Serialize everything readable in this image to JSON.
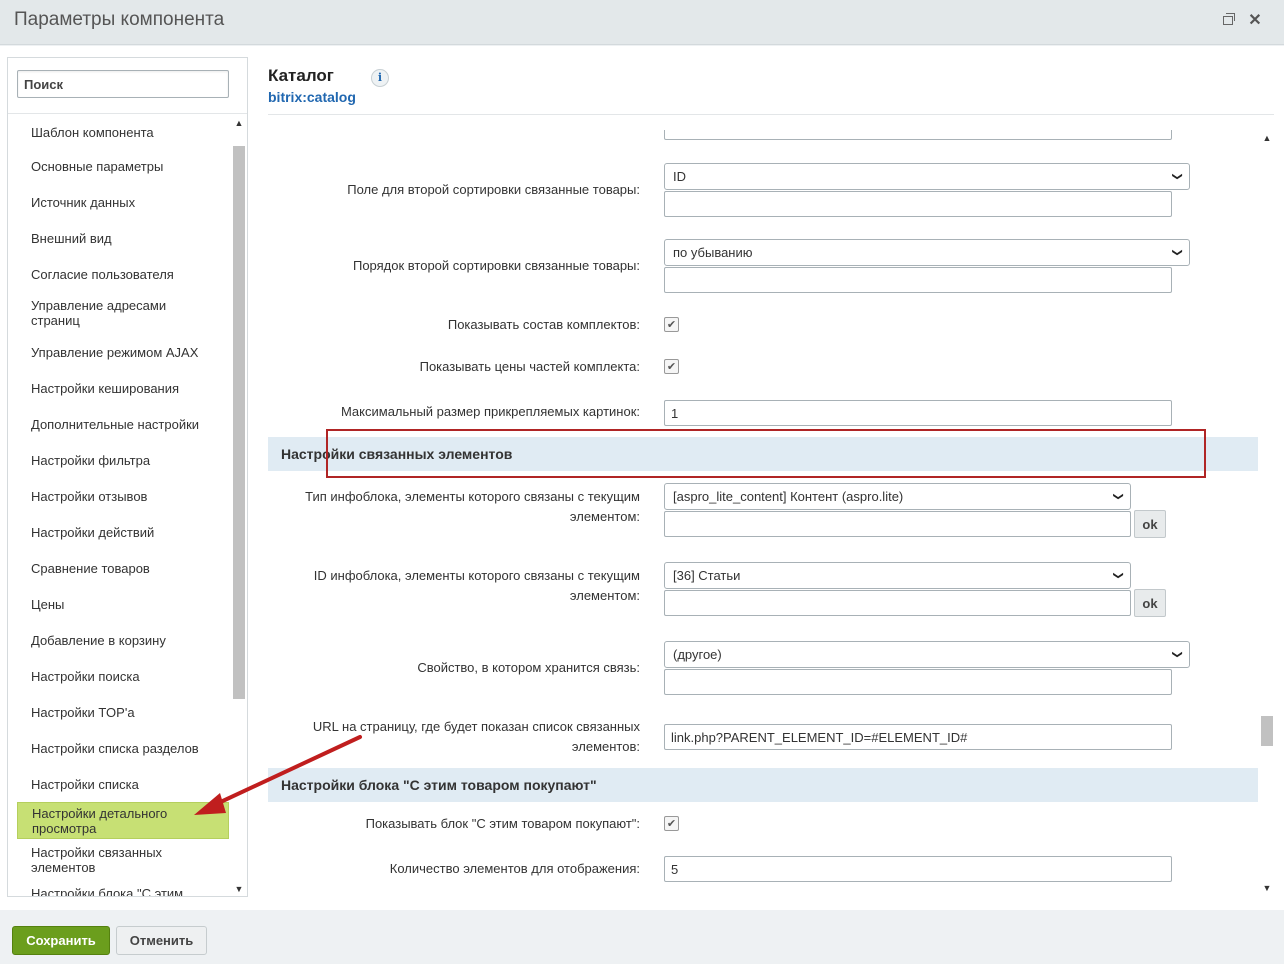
{
  "window": {
    "title": "Параметры компонента"
  },
  "search": {
    "placeholder": "Поиск"
  },
  "sidebar": {
    "items": [
      {
        "label": "Шаблон компонента"
      },
      {
        "label": "Основные параметры"
      },
      {
        "label": "Источник данных"
      },
      {
        "label": "Внешний вид"
      },
      {
        "label": "Согласие пользователя"
      },
      {
        "label": "Управление адресами страниц"
      },
      {
        "label": "Управление режимом AJAX"
      },
      {
        "label": "Настройки кеширования"
      },
      {
        "label": "Дополнительные настройки"
      },
      {
        "label": "Настройки фильтра"
      },
      {
        "label": "Настройки отзывов"
      },
      {
        "label": "Настройки действий"
      },
      {
        "label": "Сравнение товаров"
      },
      {
        "label": "Цены"
      },
      {
        "label": "Добавление в корзину"
      },
      {
        "label": "Настройки поиска"
      },
      {
        "label": "Настройки TOP'а"
      },
      {
        "label": "Настройки списка разделов"
      },
      {
        "label": "Настройки списка"
      },
      {
        "label": "Настройки детального просмотра",
        "active": true
      },
      {
        "label": "Настройки связанных элементов"
      },
      {
        "label": "Настройки блока \"С этим"
      }
    ]
  },
  "component": {
    "name": "Каталог",
    "code": "bitrix:catalog"
  },
  "form": {
    "sort2_label": "Поле для второй сортировки связанные товары:",
    "sort2_value": "ID",
    "order2_label": "Порядок второй сортировки связанные товары:",
    "order2_value": "по убыванию",
    "show_set_label": "Показывать состав комплектов:",
    "show_set_prices_label": "Показывать цены частей комплекта:",
    "max_image_label": "Максимальный размер прикрепляемых картинок:",
    "max_image_value": "1",
    "section_linked": "Настройки связанных элементов",
    "iblock_type_label": "Тип инфоблока, элементы которого связаны с текущим элементом:",
    "iblock_type_value": "[aspro_lite_content] Контент (aspro.lite)",
    "iblock_id_label": "ID инфоблока, элементы которого связаны с текущим элементом:",
    "iblock_id_value": "[36] Статьи",
    "prop_label": "Свойство, в котором хранится связь:",
    "prop_value": "(другое)",
    "url_label": "URL на страницу, где будет показан список связанных элементов:",
    "url_value": "link.php?PARENT_ELEMENT_ID=#ELEMENT_ID#",
    "section_bought": "Настройки блока \"С этим товаром покупают\"",
    "show_bought_label": "Показывать блок \"С этим товаром покупают\":",
    "count_label": "Количество элементов для отображения:",
    "count_value": "5",
    "ok_label": "ok"
  },
  "footer": {
    "save": "Сохранить",
    "cancel": "Отменить"
  },
  "icons": {
    "info": "info-icon",
    "check": "check-icon",
    "chevron": "chevron-down-icon"
  },
  "colors": {
    "accent_green": "#6b9e1d",
    "active_item": "#c7e074",
    "highlight_border": "#b02525",
    "link_blue": "#2067b0"
  }
}
